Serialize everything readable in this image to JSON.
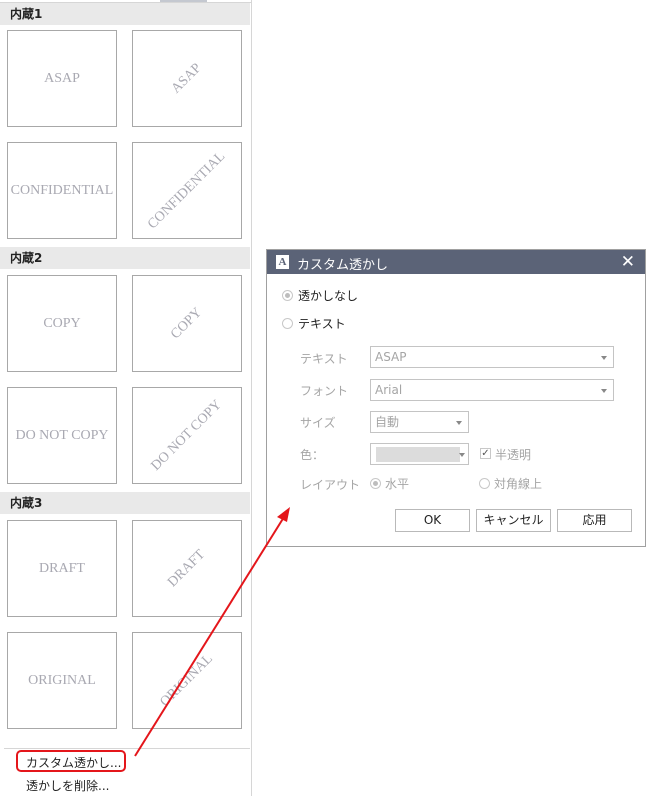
{
  "panel": {
    "sections": [
      {
        "title": "内蔵1",
        "items": [
          {
            "text": "ASAP",
            "layout": "horizontal"
          },
          {
            "text": "ASAP",
            "layout": "diagonal"
          },
          {
            "text": "CONFIDENTIAL",
            "layout": "horizontal"
          },
          {
            "text": "CONFIDENTIAL",
            "layout": "diagonal"
          }
        ]
      },
      {
        "title": "内蔵2",
        "items": [
          {
            "text": "COPY",
            "layout": "horizontal"
          },
          {
            "text": "COPY",
            "layout": "diagonal"
          },
          {
            "text": "DO NOT COPY",
            "layout": "horizontal"
          },
          {
            "text": "DO NOT COPY",
            "layout": "diagonal"
          }
        ]
      },
      {
        "title": "内蔵3",
        "items": [
          {
            "text": "DRAFT",
            "layout": "horizontal"
          },
          {
            "text": "DRAFT",
            "layout": "diagonal"
          },
          {
            "text": "ORIGINAL",
            "layout": "horizontal"
          },
          {
            "text": "ORIGINAL",
            "layout": "diagonal"
          }
        ]
      }
    ],
    "menu": {
      "custom_watermark": "カスタム透かし...",
      "remove_watermark": "透かしを削除..."
    }
  },
  "dialog": {
    "title": "カスタム透かし",
    "icon": "A",
    "options": {
      "no_watermark": "透かしなし",
      "text": "テキスト",
      "selected": "no_watermark"
    },
    "fields": {
      "text_label": "テキスト",
      "text_value": "ASAP",
      "font_label": "フォント",
      "font_value": "Arial",
      "size_label": "サイズ",
      "size_value": "自動",
      "color_label": "色：",
      "color_value": "#dcdcdc",
      "semitransparent_label": "半透明",
      "semitransparent_checked": true,
      "layout_label": "レイアウト",
      "layout_horizontal": "水平",
      "layout_diagonal": "対角線上",
      "layout_selected": "horizontal"
    },
    "buttons": {
      "ok": "OK",
      "cancel": "キャンセル",
      "apply": "応用"
    }
  },
  "annotation": {
    "highlight_color": "#e4161b"
  }
}
